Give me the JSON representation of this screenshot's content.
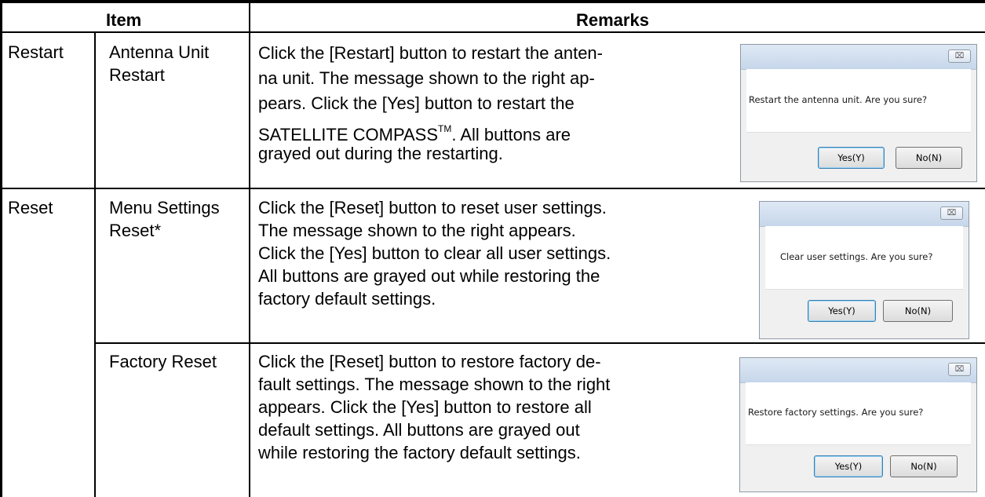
{
  "header": {
    "item": "Item",
    "remarks": "Remarks"
  },
  "rows": [
    {
      "group": "Restart",
      "item_lines": [
        "Antenna Unit",
        "Restart"
      ],
      "remark_lines": [
        "Click the [Restart] button to restart the anten-",
        "na unit. The message shown to the right ap-",
        "pears. Click the [Yes] button to restart the",
        "SATELLITE COMPASS",
        ". All buttons are",
        "grayed out during the restarting."
      ],
      "trademark": "TM",
      "dialog": {
        "close_glyph": "⌧",
        "message": "Restart the antenna unit. Are you sure?",
        "yes": "Yes(Y)",
        "no": "No(N)"
      }
    },
    {
      "group": "Reset",
      "item_lines": [
        "Menu Settings",
        "Reset*"
      ],
      "remark_lines": [
        "Click the [Reset] button to reset user settings.",
        "The message shown to the right appears.",
        "Click the [Yes] button to clear all user settings.",
        "All buttons are grayed out while restoring the",
        "factory default settings."
      ],
      "dialog": {
        "close_glyph": "⌧",
        "message": "Clear user settings. Are you sure?",
        "yes": "Yes(Y)",
        "no": "No(N)"
      }
    },
    {
      "group": "",
      "item_lines": [
        "Factory Reset"
      ],
      "remark_lines": [
        "Click the [Reset] button to restore factory de-",
        "fault settings. The message shown to the right",
        "appears. Click the [Yes] button to restore all",
        "default settings. All buttons are grayed out",
        "while restoring the factory default settings."
      ],
      "dialog": {
        "close_glyph": "⌧",
        "message": "Restore factory settings. Are you sure?",
        "yes": "Yes(Y)",
        "no": "No(N)"
      }
    }
  ]
}
